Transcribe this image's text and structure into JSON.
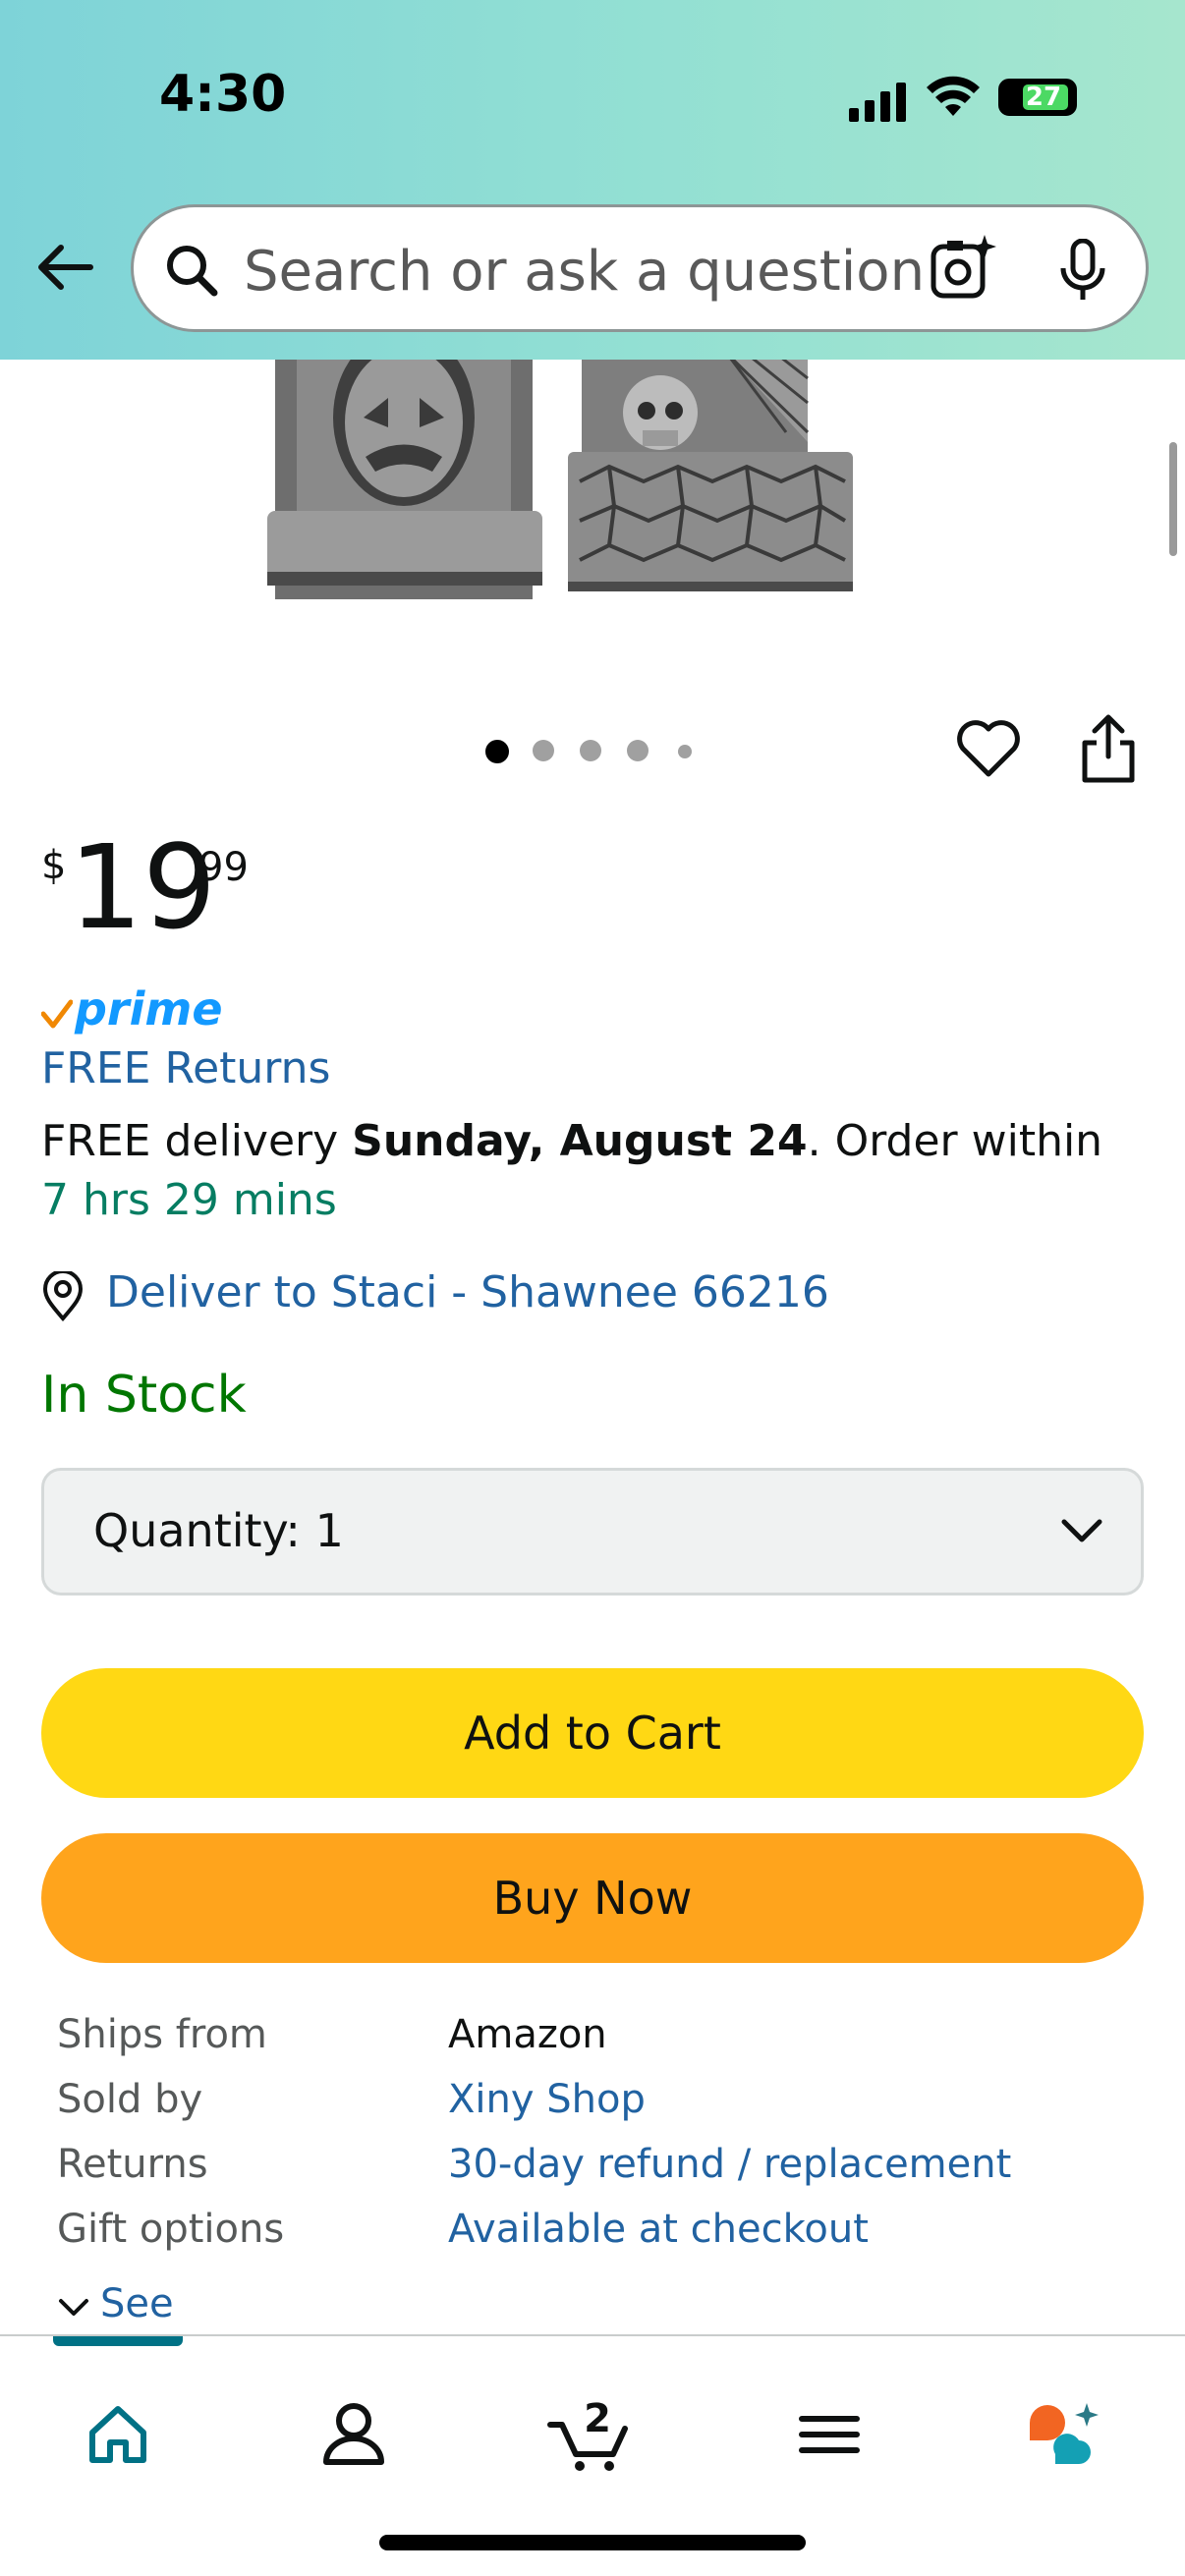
{
  "status_bar": {
    "time": "4:30",
    "battery": "27"
  },
  "header": {
    "search_placeholder": "Search or ask a question"
  },
  "product": {
    "image_dots": 5,
    "price": {
      "symbol": "$",
      "whole": "19",
      "fraction": "99"
    },
    "prime_label": "prime",
    "free_returns": "FREE Returns",
    "delivery": {
      "prefix": "FREE delivery ",
      "date": "Sunday, August 24",
      "middle": ". Order within ",
      "countdown": "7 hrs 29 mins"
    },
    "deliver_to": "Deliver to Staci - Shawnee 66216",
    "stock_status": "In Stock",
    "quantity_label": "Quantity:",
    "quantity_value": "1",
    "add_to_cart": "Add to Cart",
    "buy_now": "Buy Now",
    "details": [
      {
        "label": "Ships from",
        "value": "Amazon",
        "link": false
      },
      {
        "label": "Sold by",
        "value": "Xiny Shop",
        "link": true
      },
      {
        "label": "Returns",
        "value": "30-day refund / replacement",
        "link": true
      },
      {
        "label": "Gift options",
        "value": "Available at checkout",
        "link": true
      }
    ],
    "see_more": "See more"
  },
  "bottom_nav": {
    "cart_count": "2",
    "items": [
      "home-icon",
      "account-icon",
      "cart-icon",
      "menu-icon",
      "rufus-icon"
    ]
  },
  "colors": {
    "link": "#2162a1",
    "add_to_cart": "#ffd814",
    "buy_now": "#ffa41c",
    "in_stock": "#007600",
    "countdown": "#067d62",
    "prime": "#1399ff"
  }
}
